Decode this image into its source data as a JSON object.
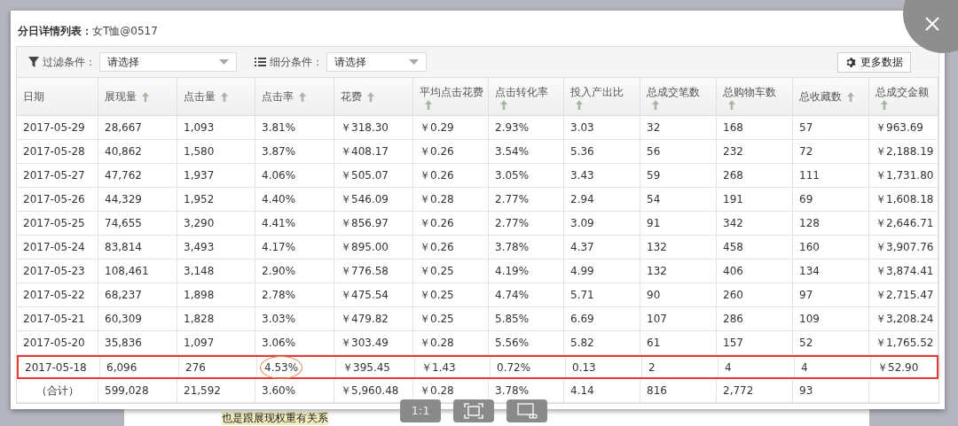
{
  "dialog": {
    "title_label": "分日详情列表：",
    "title_value": "女T恤@0517"
  },
  "toolbar": {
    "filter": {
      "label": "过滤条件：",
      "value": "请选择"
    },
    "segment": {
      "label": "细分条件：",
      "value": "请选择"
    },
    "more_button": "更多数据"
  },
  "table": {
    "columns": [
      {
        "label": "日期",
        "sortable": false
      },
      {
        "label": "展现量",
        "sortable": true
      },
      {
        "label": "点击量",
        "sortable": true
      },
      {
        "label": "点击率",
        "sortable": true
      },
      {
        "label": "花费",
        "sortable": true
      },
      {
        "label": "平均点击花费",
        "sortable": true
      },
      {
        "label": "点击转化率",
        "sortable": true
      },
      {
        "label": "投入产出比",
        "sortable": true
      },
      {
        "label": "总成交笔数",
        "sortable": true
      },
      {
        "label": "总购物车数",
        "sortable": true
      },
      {
        "label": "总收藏数",
        "sortable": true
      },
      {
        "label": "总成交金额",
        "sortable": true
      }
    ],
    "rows": [
      {
        "kind": "data",
        "highlighted": false,
        "cells": [
          "2017-05-29",
          "28,667",
          "1,093",
          "3.81%",
          "￥318.30",
          "￥0.29",
          "2.93%",
          "3.03",
          "32",
          "168",
          "57",
          "￥963.69"
        ]
      },
      {
        "kind": "data",
        "highlighted": false,
        "cells": [
          "2017-05-28",
          "40,862",
          "1,580",
          "3.87%",
          "￥408.17",
          "￥0.26",
          "3.54%",
          "5.36",
          "56",
          "232",
          "72",
          "￥2,188.19"
        ]
      },
      {
        "kind": "data",
        "highlighted": false,
        "cells": [
          "2017-05-27",
          "47,762",
          "1,937",
          "4.06%",
          "￥505.07",
          "￥0.26",
          "3.05%",
          "3.43",
          "59",
          "268",
          "111",
          "￥1,731.80"
        ]
      },
      {
        "kind": "data",
        "highlighted": false,
        "cells": [
          "2017-05-26",
          "44,329",
          "1,952",
          "4.40%",
          "￥546.09",
          "￥0.28",
          "2.77%",
          "2.94",
          "54",
          "191",
          "69",
          "￥1,608.18"
        ]
      },
      {
        "kind": "data",
        "highlighted": false,
        "cells": [
          "2017-05-25",
          "74,655",
          "3,290",
          "4.41%",
          "￥856.97",
          "￥0.26",
          "2.77%",
          "3.09",
          "91",
          "342",
          "128",
          "￥2,646.71"
        ]
      },
      {
        "kind": "data",
        "highlighted": false,
        "cells": [
          "2017-05-24",
          "83,814",
          "3,493",
          "4.17%",
          "￥895.00",
          "￥0.26",
          "3.78%",
          "4.37",
          "132",
          "458",
          "160",
          "￥3,907.76"
        ]
      },
      {
        "kind": "data",
        "highlighted": false,
        "cells": [
          "2017-05-23",
          "108,461",
          "3,148",
          "2.90%",
          "￥776.58",
          "￥0.25",
          "4.19%",
          "4.99",
          "132",
          "406",
          "134",
          "￥3,874.41"
        ]
      },
      {
        "kind": "data",
        "highlighted": false,
        "cells": [
          "2017-05-22",
          "68,237",
          "1,898",
          "2.78%",
          "￥475.54",
          "￥0.25",
          "4.74%",
          "5.71",
          "90",
          "260",
          "97",
          "￥2,715.47"
        ]
      },
      {
        "kind": "data",
        "highlighted": false,
        "cells": [
          "2017-05-21",
          "60,309",
          "1,828",
          "3.03%",
          "￥479.82",
          "￥0.25",
          "5.85%",
          "6.69",
          "107",
          "286",
          "109",
          "￥3,208.24"
        ]
      },
      {
        "kind": "data",
        "highlighted": false,
        "cells": [
          "2017-05-20",
          "35,836",
          "1,097",
          "3.06%",
          "￥303.49",
          "￥0.28",
          "5.56%",
          "5.82",
          "61",
          "157",
          "52",
          "￥1,765.52"
        ]
      },
      {
        "kind": "data",
        "highlighted": true,
        "cells": [
          {
            "text": "2017-05-18",
            "circled": false
          },
          {
            "text": "6,096",
            "circled": false
          },
          {
            "text": "276",
            "circled": false
          },
          {
            "text": "4.53%",
            "circled": true
          },
          {
            "text": "￥395.45",
            "circled": false
          },
          {
            "text": "￥1.43",
            "circled": false
          },
          {
            "text": "0.72%",
            "circled": false
          },
          {
            "text": "0.13",
            "circled": false
          },
          {
            "text": "2",
            "circled": false
          },
          {
            "text": "4",
            "circled": false
          },
          {
            "text": "4",
            "circled": false
          },
          {
            "text": "￥52.90",
            "circled": false
          }
        ]
      },
      {
        "kind": "total",
        "highlighted": false,
        "cells": [
          "（合计）",
          "599,028",
          "21,592",
          "3.60%",
          "￥5,960.48",
          "￥0.28",
          "3.78%",
          "4.14",
          "816",
          "2,772",
          "93"
        ]
      }
    ]
  },
  "viewer_controls": [
    {
      "kind": "text",
      "label": "1:1"
    },
    {
      "kind": "fit"
    },
    {
      "kind": "crop"
    }
  ],
  "background_text": "也是跟展现权重有关系"
}
